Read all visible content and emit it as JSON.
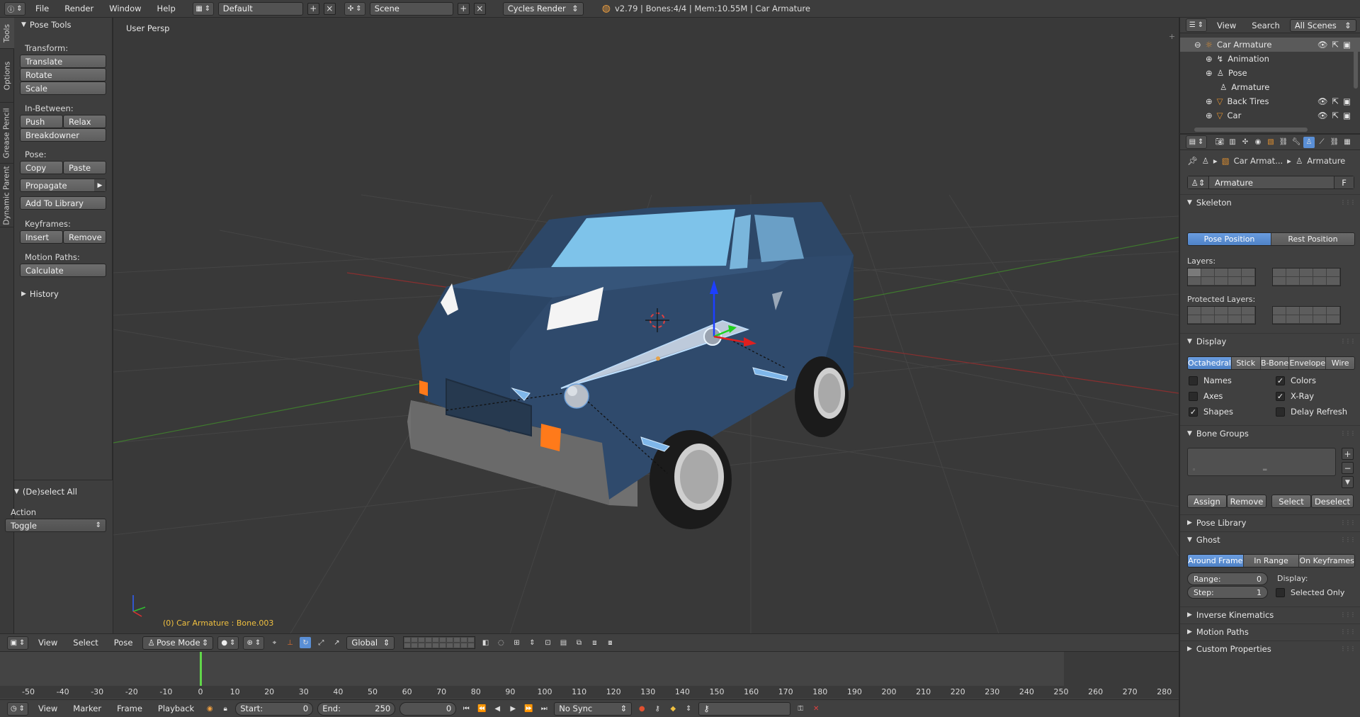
{
  "topbar": {
    "menus": [
      "File",
      "Render",
      "Window",
      "Help"
    ],
    "screen_layout": "Default",
    "scene": "Scene",
    "render_engine": "Cycles Render",
    "stats": "v2.79 | Bones:4/4  | Mem:10.55M | Car Armature"
  },
  "tabs": [
    "Tools",
    "Options",
    "Grease Pencil",
    "Dynamic Parent"
  ],
  "toolshelf": {
    "header": "Pose Tools",
    "transform_label": "Transform:",
    "translate": "Translate",
    "rotate": "Rotate",
    "scale": "Scale",
    "inbetween_label": "In-Between:",
    "push": "Push",
    "relax": "Relax",
    "breakdowner": "Breakdowner",
    "pose_label": "Pose:",
    "copy": "Copy",
    "paste": "Paste",
    "propagate": "Propagate",
    "add_to_library": "Add To Library",
    "keyframes_label": "Keyframes:",
    "insert": "Insert",
    "remove": "Remove",
    "motion_paths_label": "Motion Paths:",
    "calculate": "Calculate",
    "history": "History"
  },
  "operator": {
    "header": "(De)select All",
    "action_label": "Action",
    "action_value": "Toggle"
  },
  "viewport": {
    "view_label": "User Persp",
    "object_label": "(0) Car Armature : Bone.003"
  },
  "viewport_header": {
    "menus": [
      "View",
      "Select",
      "Pose"
    ],
    "mode": "Pose Mode",
    "orientation": "Global"
  },
  "timeline": {
    "ticks": [
      "-50",
      "-40",
      "-30",
      "-20",
      "-10",
      "0",
      "10",
      "20",
      "30",
      "40",
      "50",
      "60",
      "70",
      "80",
      "90",
      "100",
      "110",
      "120",
      "130",
      "140",
      "150",
      "160",
      "170",
      "180",
      "190",
      "200",
      "210",
      "220",
      "230",
      "240",
      "250",
      "260",
      "270",
      "280"
    ],
    "menus": [
      "View",
      "Marker",
      "Frame",
      "Playback"
    ],
    "start_label": "Start:",
    "start_value": "0",
    "end_label": "End:",
    "end_value": "250",
    "current_frame": "0",
    "sync": "No Sync"
  },
  "outliner": {
    "menus": [
      "View",
      "Search"
    ],
    "filter": "All Scenes",
    "items": [
      "Car Armature",
      "Animation",
      "Pose",
      "Armature",
      "Back Tires",
      "Car"
    ]
  },
  "properties": {
    "breadcrumb_object": "Car Armat...",
    "breadcrumb_data": "Armature",
    "datablock_name": "Armature",
    "datablock_fake": "F",
    "skeleton": {
      "header": "Skeleton",
      "pose_position": "Pose Position",
      "rest_position": "Rest Position",
      "layers_label": "Layers:",
      "protected_layers_label": "Protected Layers:"
    },
    "display": {
      "header": "Display",
      "modes": [
        "Octahedral",
        "Stick",
        "B-Bone",
        "Envelope",
        "Wire"
      ],
      "names": "Names",
      "axes": "Axes",
      "shapes": "Shapes",
      "colors": "Colors",
      "xray": "X-Ray",
      "delay_refresh": "Delay Refresh"
    },
    "bone_groups": {
      "header": "Bone Groups",
      "assign": "Assign",
      "remove": "Remove",
      "select": "Select",
      "deselect": "Deselect"
    },
    "pose_library": "Pose Library",
    "ghost": {
      "header": "Ghost",
      "modes": [
        "Around Frame",
        "In Range",
        "On Keyframes"
      ],
      "range_label": "Range:",
      "range_value": "0",
      "step_label": "Step:",
      "step_value": "1",
      "display_label": "Display:",
      "selected_only": "Selected Only"
    },
    "inverse_kinematics": "Inverse Kinematics",
    "motion_paths": "Motion Paths",
    "custom_properties": "Custom Properties"
  },
  "colors": {
    "accent": "#5a8fd6",
    "frame_cursor": "#61d64a",
    "car_body": "#2f4a6c",
    "window_glass": "#7ec3ea"
  }
}
